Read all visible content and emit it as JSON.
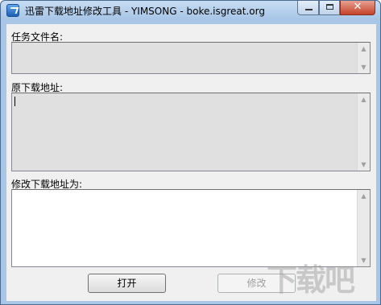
{
  "window": {
    "title": "迅雷下载地址修改工具 - YIMSONG - boke.isgreat.org",
    "controls": {
      "minimize_icon": "minimize-icon",
      "maximize_icon": "maximize-icon",
      "close_glyph": "✕"
    }
  },
  "form": {
    "task_filename_label": "任务文件名:",
    "task_filename_value": "",
    "original_url_label": "原下载地址:",
    "original_url_value": "",
    "new_url_label": "修改下载地址为:",
    "new_url_value": ""
  },
  "buttons": {
    "open_label": "打开",
    "modify_label": "修改"
  },
  "watermark": {
    "text": "下载吧"
  }
}
